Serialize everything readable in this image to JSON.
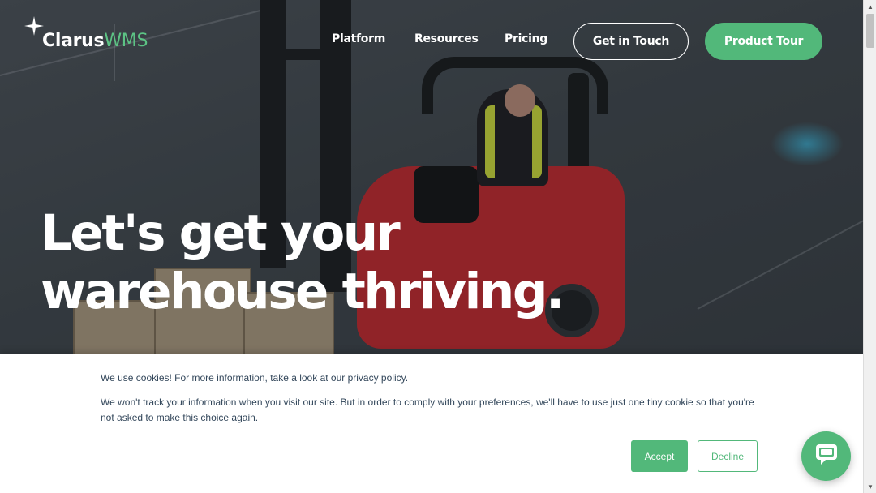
{
  "logo": {
    "name_bold": "Clarus",
    "name_light": "WMS",
    "icon": "sparkle-icon"
  },
  "nav": {
    "items": [
      {
        "label": "Platform"
      },
      {
        "label": "Resources"
      },
      {
        "label": "Pricing"
      }
    ],
    "get_in_touch": "Get in Touch",
    "product_tour": "Product Tour"
  },
  "hero": {
    "headline_line1": "Let's get your",
    "headline_line2": "warehouse thriving."
  },
  "cookie_banner": {
    "text1": "We use cookies! For more information, take a look at our privacy policy.",
    "text2": "We won't track your information when you visit our site. But in order to comply with your preferences, we'll have to use just one tiny cookie so that you're not asked to make this choice again.",
    "accept_label": "Accept",
    "decline_label": "Decline"
  },
  "chat": {
    "icon": "chat-bubble-icon"
  },
  "colors": {
    "accent": "#52b87a",
    "logo_accent": "#5cc384",
    "cookie_text": "#33475b"
  }
}
